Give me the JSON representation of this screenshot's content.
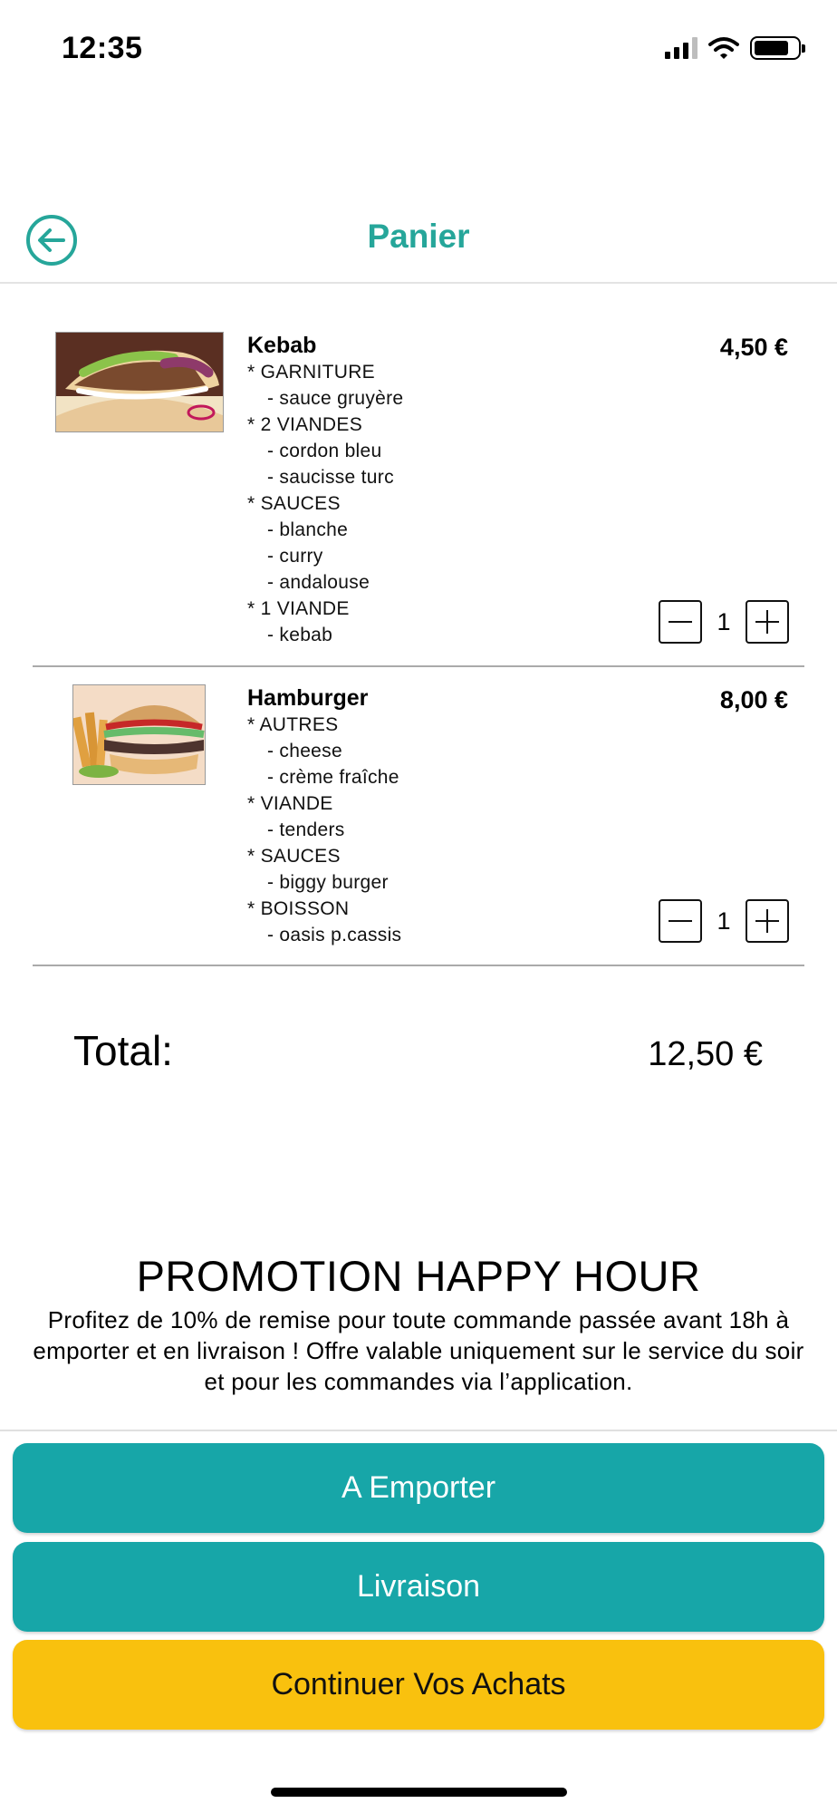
{
  "status_bar": {
    "time": "12:35",
    "icons": [
      "signal-icon",
      "wifi-icon",
      "battery-icon"
    ]
  },
  "header": {
    "title": "Panier",
    "back_icon": "arrow-left-circle-icon"
  },
  "cart": {
    "items": [
      {
        "name": "Kebab",
        "price": "4,50 €",
        "quantity": "1",
        "options": [
          {
            "group": "* GARNITURE",
            "values": [
              "- sauce gruyère"
            ]
          },
          {
            "group": "* 2 VIANDES",
            "values": [
              "- cordon bleu",
              "- saucisse turc"
            ]
          },
          {
            "group": "* SAUCES",
            "values": [
              "- blanche",
              "- curry",
              "- andalouse"
            ]
          },
          {
            "group": "* 1 VIANDE",
            "values": [
              "- kebab"
            ]
          }
        ]
      },
      {
        "name": "Hamburger",
        "price": "8,00 €",
        "quantity": "1",
        "options": [
          {
            "group": "* AUTRES",
            "values": [
              "- cheese",
              "- crème fraîche"
            ]
          },
          {
            "group": "* VIANDE",
            "values": [
              "- tenders"
            ]
          },
          {
            "group": "* SAUCES",
            "values": [
              "- biggy burger"
            ]
          },
          {
            "group": "* BOISSON",
            "values": [
              "- oasis p.cassis"
            ]
          }
        ]
      }
    ],
    "total_label": "Total:",
    "total_value": "12,50 €"
  },
  "promotion": {
    "title": "PROMOTION HAPPY HOUR",
    "text": "Profitez de 10% de remise pour toute commande passée avant 18h à emporter et en livraison ! Offre valable uniquement sur le service du soir et pour les commandes via l’application."
  },
  "actions": {
    "takeaway": "A Emporter",
    "delivery": "Livraison",
    "continue": "Continuer Vos Achats"
  },
  "colors": {
    "accent": "#26a69a",
    "button_teal": "#17a6a8",
    "button_yellow": "#f9c10e"
  }
}
